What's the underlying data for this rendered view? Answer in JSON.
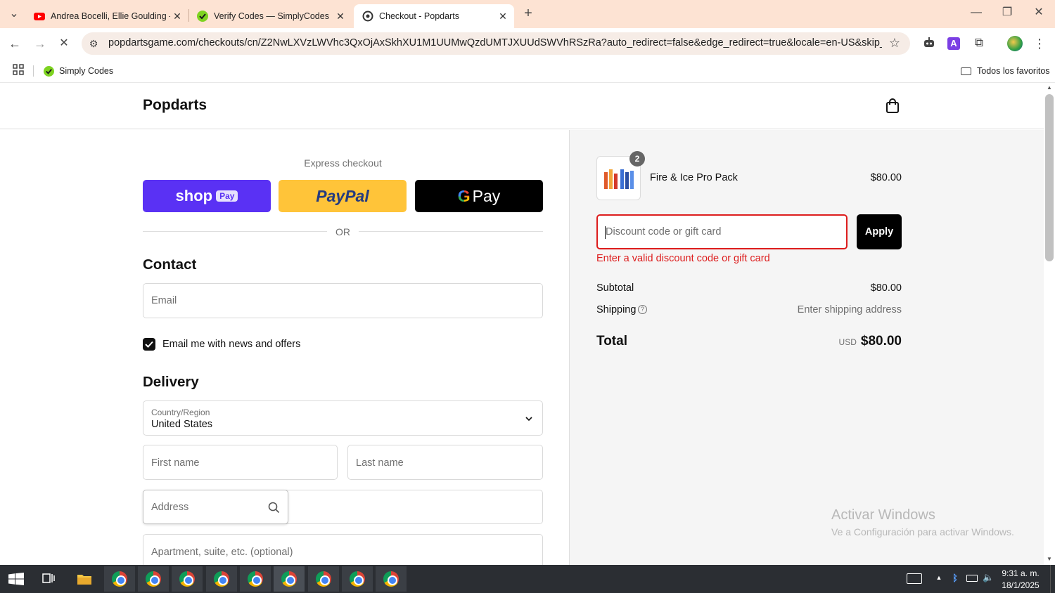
{
  "browser": {
    "tabs": [
      {
        "title": "Andrea Bocelli, Ellie Goulding -",
        "close": "✕"
      },
      {
        "title": "Verify Codes — SimplyCodes",
        "close": "✕"
      },
      {
        "title": "Checkout - Popdarts",
        "close": "✕"
      }
    ],
    "new_tab": "+",
    "url": "popdartsgame.com/checkouts/cn/Z2NwLXVzLWVhc3QxOjAxSkhXU1M1UUMwQzdUMTJXUUdSWVhRSzRa?auto_redirect=false&edge_redirect=true&locale=en-US&skip_shop_pay=...",
    "bookmark_item": "Simply Codes",
    "all_bookmarks": "Todos los favoritos"
  },
  "store": {
    "brand": "Popdarts"
  },
  "express": {
    "label": "Express checkout",
    "shop_pay": "shop",
    "shop_pay_badge": "Pay",
    "paypal": "PayPal",
    "gpay": "Pay",
    "or": "OR"
  },
  "contact": {
    "title": "Contact",
    "email_placeholder": "Email",
    "newsletter_label": "Email me with news and offers"
  },
  "delivery": {
    "title": "Delivery",
    "country_label": "Country/Region",
    "country_value": "United States",
    "first_name": "First name",
    "last_name": "Last name",
    "address": "Address",
    "apartment": "Apartment, suite, etc. (optional)"
  },
  "summary": {
    "item_name": "Fire & Ice Pro Pack",
    "item_price": "$80.00",
    "item_qty": "2",
    "discount_placeholder": "Discount code or gift card",
    "apply": "Apply",
    "error": "Enter a valid discount code or gift card",
    "subtotal_label": "Subtotal",
    "subtotal_value": "$80.00",
    "shipping_label": "Shipping",
    "shipping_value": "Enter shipping address",
    "total_label": "Total",
    "currency": "USD",
    "total_value": "$80.00"
  },
  "watermark": {
    "line1": "Activar Windows",
    "line2": "Ve a Configuración para activar Windows."
  },
  "taskbar": {
    "time": "9:31 a. m.",
    "date": "18/1/2025"
  },
  "colors": {
    "shop_pay": "#5a31f4",
    "paypal": "#ffc439",
    "gpay": "#000000",
    "error": "#dd1d1d",
    "tabbar": "#fde3d3"
  }
}
